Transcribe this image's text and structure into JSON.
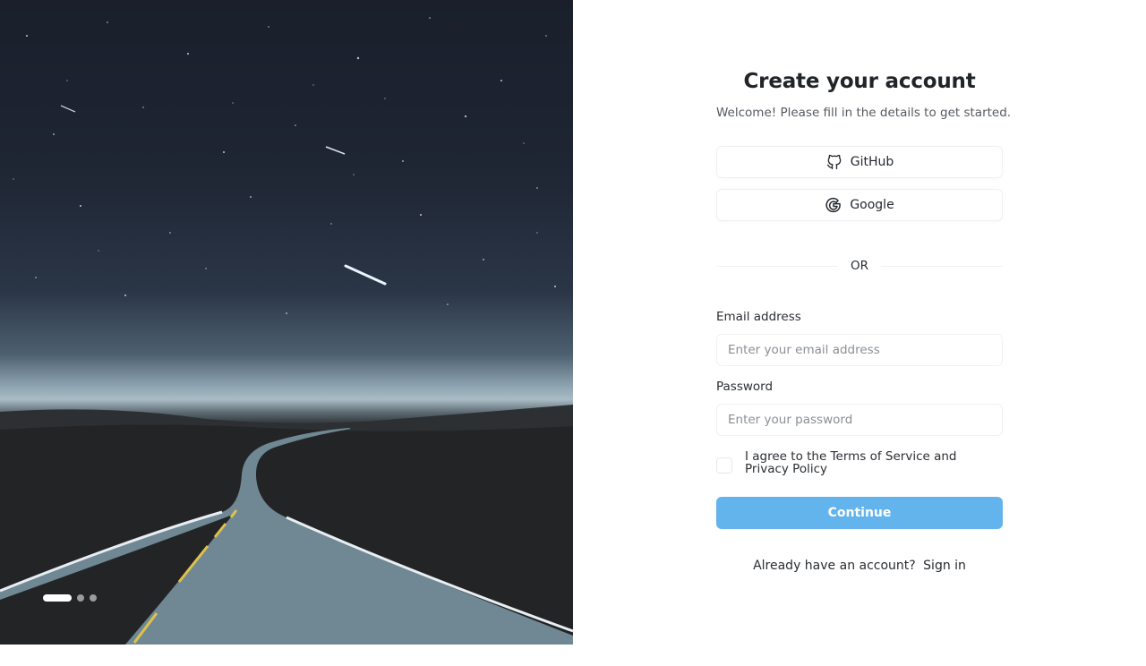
{
  "hero": {
    "icon": "night-road-photo",
    "carousel": {
      "count": 3,
      "active_index": 0
    }
  },
  "form": {
    "title": "Create your account",
    "subtitle": "Welcome! Please fill in the details to get started.",
    "social": [
      {
        "label": "GitHub",
        "icon": "github-icon"
      },
      {
        "label": "Google",
        "icon": "google-icon"
      }
    ],
    "divider_text": "OR",
    "email": {
      "label": "Email address",
      "placeholder": "Enter your email address",
      "value": ""
    },
    "password": {
      "label": "Password",
      "placeholder": "Enter your password",
      "value": ""
    },
    "agree": {
      "text": "I agree to the Terms of Service and Privacy Policy",
      "checked": false
    },
    "continue_label": "Continue",
    "signin_prompt": "Already have an account?",
    "signin_link": "Sign in"
  },
  "colors": {
    "accent": "#63b3ed",
    "text": "#212529"
  }
}
